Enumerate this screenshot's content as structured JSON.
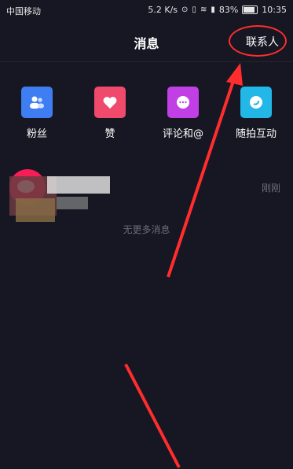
{
  "status_bar": {
    "carrier": "中国移动",
    "network_speed": "5.2 K/s",
    "battery": "83%",
    "time": "10:35"
  },
  "nav": {
    "title": "消息",
    "contacts": "联系人"
  },
  "quick_actions": [
    {
      "label": "粉丝",
      "icon": "fans-icon",
      "color": "#3f7ef2"
    },
    {
      "label": "赞",
      "icon": "heart-icon",
      "color": "#ef4a6b"
    },
    {
      "label": "评论和@",
      "icon": "comment-icon",
      "color": "#c040e6"
    },
    {
      "label": "随拍互动",
      "icon": "moon-icon",
      "color": "#23b7e8"
    }
  ],
  "message": {
    "time": "刚刚"
  },
  "footer": {
    "no_more": "无更多消息"
  },
  "annotation_color": "#ff2d2d"
}
